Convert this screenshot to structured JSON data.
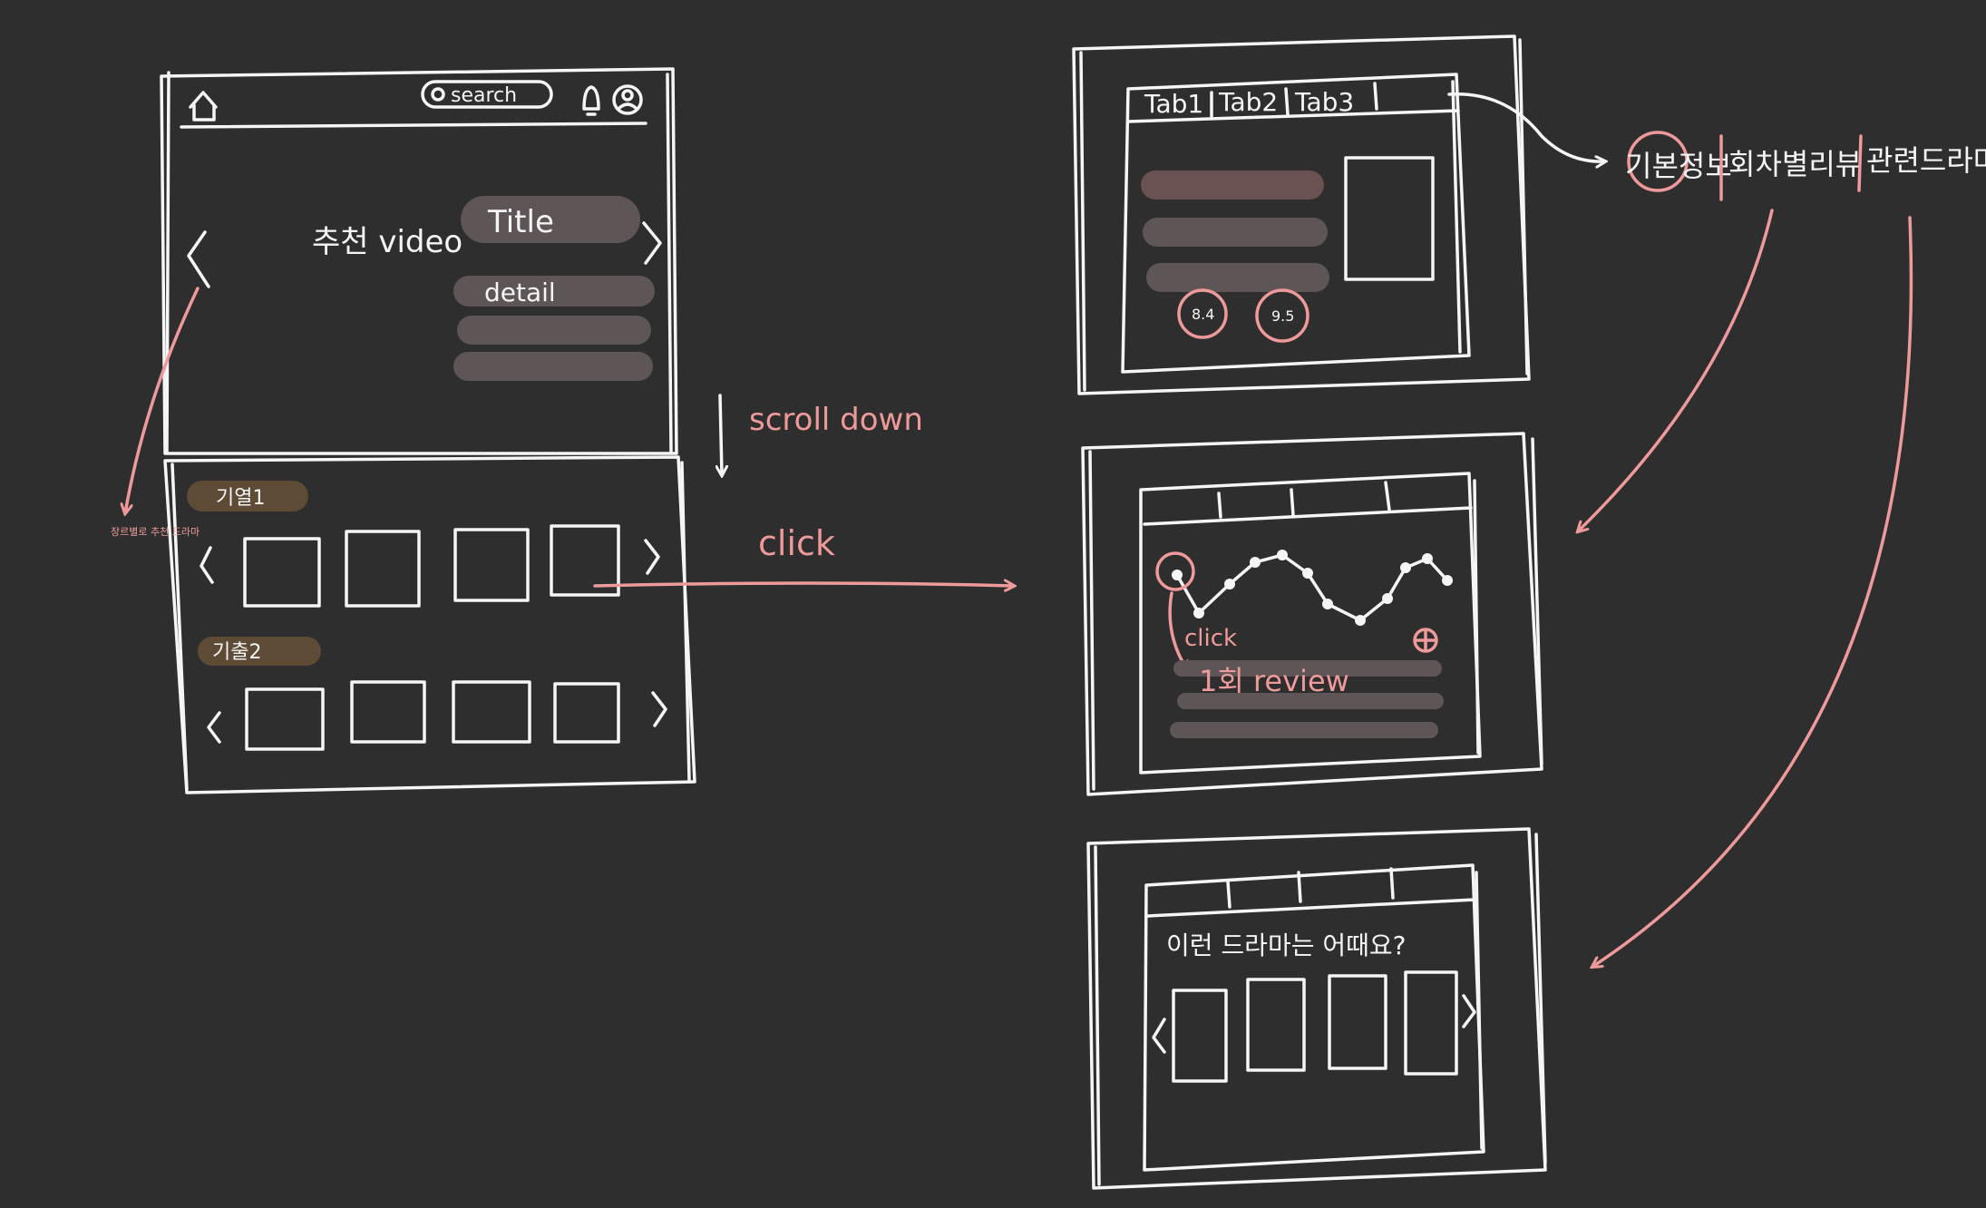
{
  "colors": {
    "background": "#2e2e2e",
    "stroke": "#f5f5f5",
    "annotation": "#ef9a9a",
    "bar": "#5e5656",
    "bar_highlight": "#6a5252",
    "genre_tag": "#5e4b36"
  },
  "main_screen": {
    "search_label": "search",
    "search_icon": "magnifier-icon",
    "home_icon": "home-icon",
    "bell_icon": "bell-icon",
    "profile_icon": "profile-icon",
    "hero_label": "추천 video",
    "hero_title": "Title",
    "hero_detail": "detail",
    "genre_1_label": "기열1",
    "genre_2_label": "기출2",
    "genre_note": "장르별로 추천 드라마"
  },
  "annotations": {
    "scroll": "scroll down",
    "click": "click",
    "tabs_legend": [
      "기본정보",
      "회차별리뷰",
      "관련드라마"
    ]
  },
  "detail_screen": {
    "tabs": [
      "Tab1",
      "Tab2",
      "Tab3"
    ],
    "ratings": [
      "8.4",
      "9.5"
    ]
  },
  "review_screen": {
    "click_note": "click",
    "review_label": "1회 review",
    "add_icon": "plus-circle-icon"
  },
  "related_screen": {
    "question": "이런 드라마는 어때요?"
  }
}
